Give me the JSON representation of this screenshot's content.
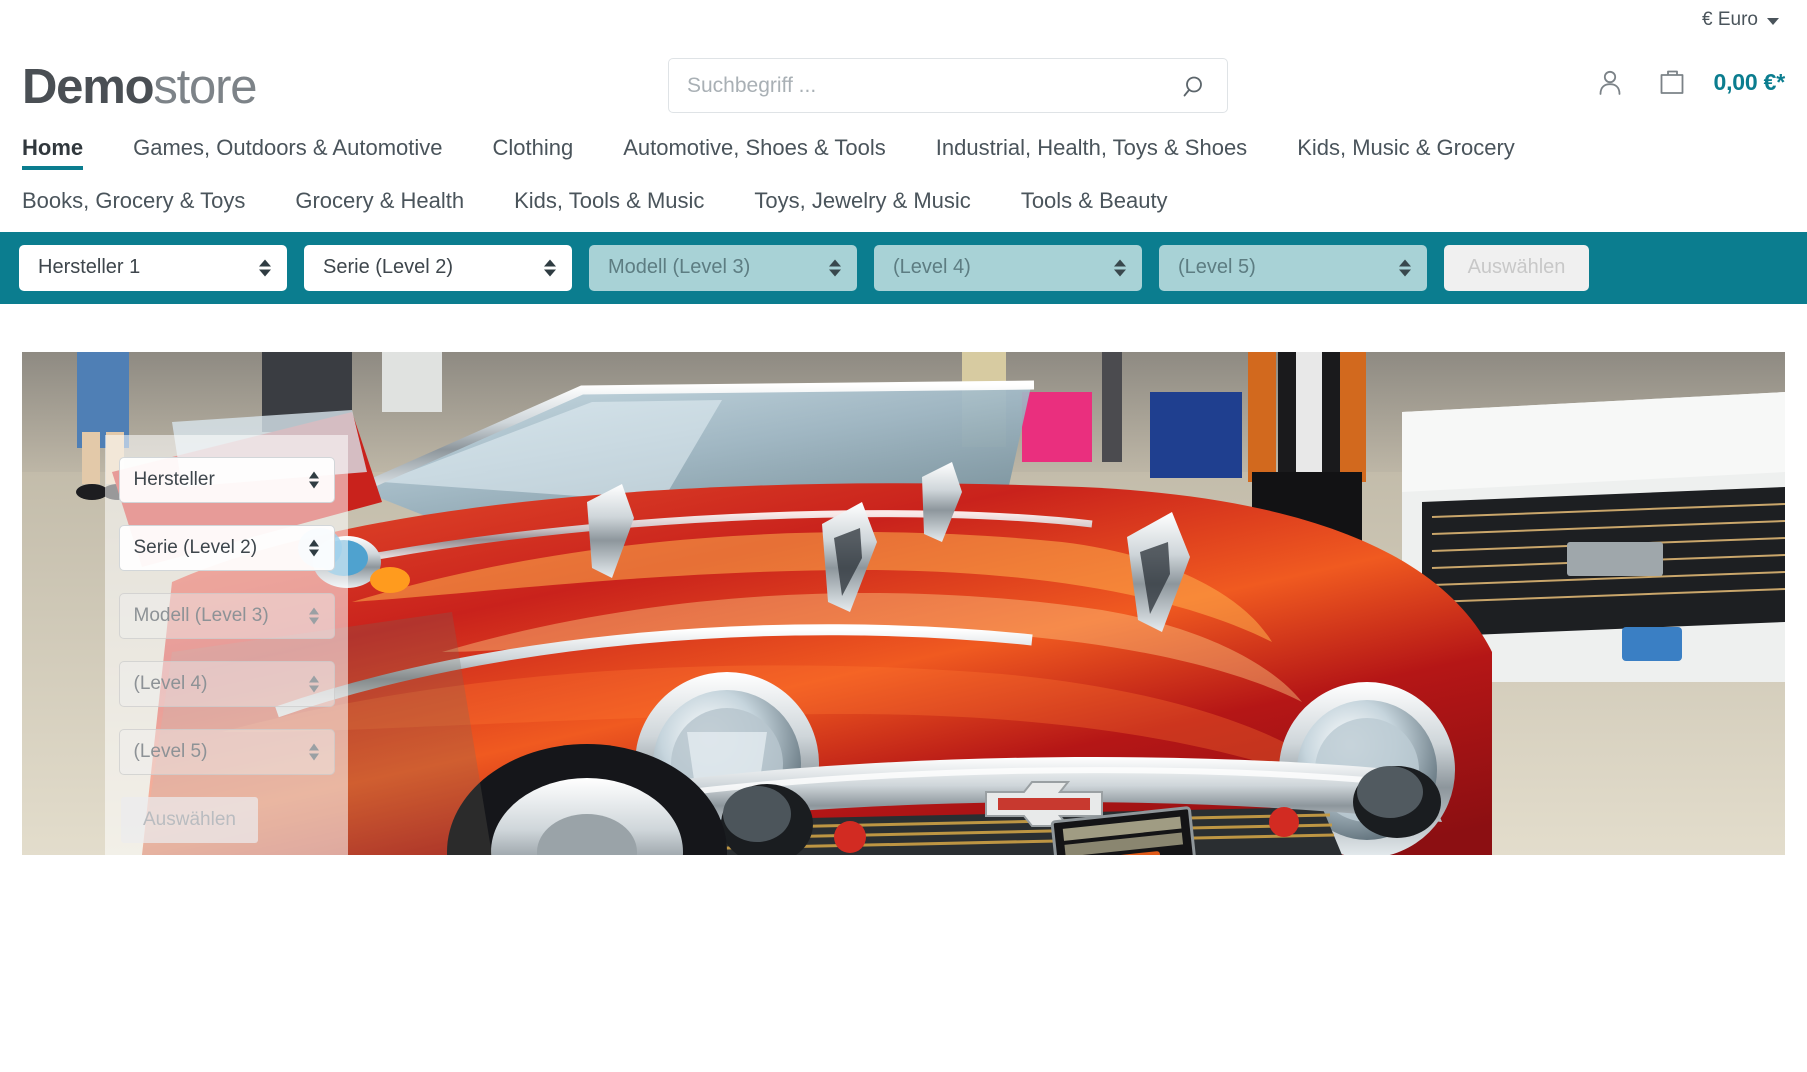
{
  "topbar": {
    "currency_label": "€ Euro",
    "currency_icon": "chevron-down-icon"
  },
  "header": {
    "logo_bold": "Demo",
    "logo_light": "store",
    "search": {
      "placeholder": "Suchbegriff ...",
      "value": "",
      "icon": "search-icon"
    },
    "account_icon": "user-icon",
    "cart_icon": "shopping-bag-icon",
    "cart_total": "0,00 €*"
  },
  "nav": {
    "row1": [
      {
        "label": "Home",
        "active": true
      },
      {
        "label": "Games, Outdoors & Automotive",
        "active": false
      },
      {
        "label": "Clothing",
        "active": false
      },
      {
        "label": "Automotive, Shoes & Tools",
        "active": false
      },
      {
        "label": "Industrial, Health, Toys & Shoes",
        "active": false
      },
      {
        "label": "Kids, Music & Grocery",
        "active": false
      }
    ],
    "row2": [
      {
        "label": "Books, Grocery & Toys",
        "active": false
      },
      {
        "label": "Grocery & Health",
        "active": false
      },
      {
        "label": "Kids, Tools & Music",
        "active": false
      },
      {
        "label": "Toys, Jewelry & Music",
        "active": false
      },
      {
        "label": "Tools & Beauty",
        "active": false
      }
    ]
  },
  "filterbar": {
    "background_color": "#0b7d8f",
    "selects": [
      {
        "value": "Hersteller 1",
        "disabled": false
      },
      {
        "value": "Serie (Level 2)",
        "disabled": false
      },
      {
        "value": "Modell (Level 3)",
        "disabled": true
      },
      {
        "value": "(Level 4)",
        "disabled": true
      },
      {
        "value": "(Level 5)",
        "disabled": true
      }
    ],
    "submit_label": "Auswählen",
    "submit_disabled": true
  },
  "hero": {
    "alt": "Classic red 1957 Chevrolet Bel Air at a car show",
    "overlay": {
      "selects": [
        {
          "value": "Hersteller",
          "disabled": false
        },
        {
          "value": "Serie (Level 2)",
          "disabled": false
        },
        {
          "value": "Modell (Level 3)",
          "disabled": true
        },
        {
          "value": "(Level 4)",
          "disabled": true
        },
        {
          "value": "(Level 5)",
          "disabled": true
        }
      ],
      "submit_label": "Auswählen",
      "submit_disabled": true
    }
  },
  "colors": {
    "accent_teal": "#0b7d8f",
    "text_dark": "#4a545b",
    "muted": "#a9b0b5"
  }
}
